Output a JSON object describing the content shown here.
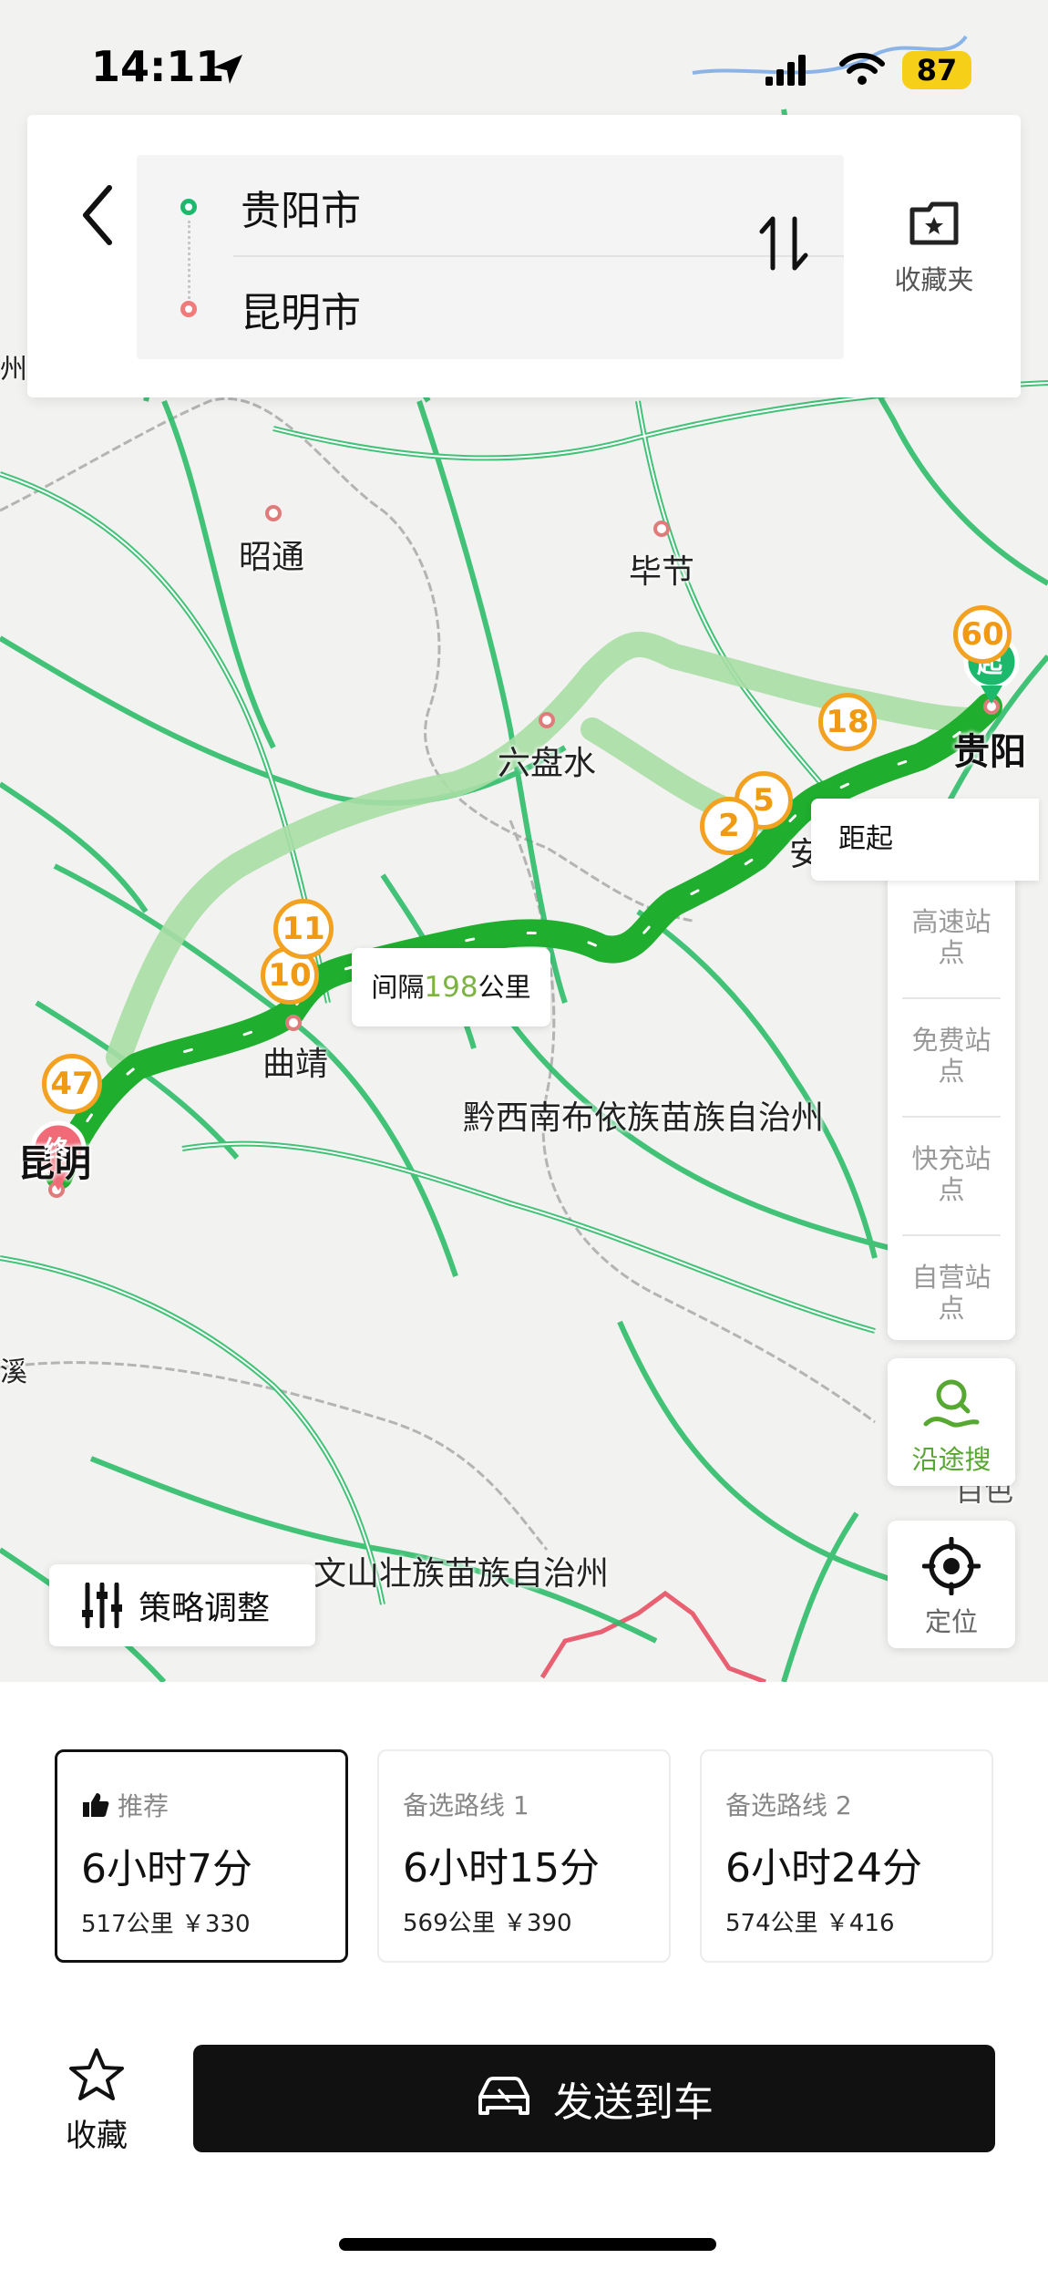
{
  "status_bar": {
    "time": "14:11",
    "battery": "87"
  },
  "route_card": {
    "start": "贵阳市",
    "end": "昆明市",
    "favorites_label": "收藏夹"
  },
  "map": {
    "labels": {
      "zhaotong": "昭通",
      "bijie": "毕节",
      "liupanshui": "六盘水",
      "guiyang": "贵阳",
      "qujing": "曲靖",
      "kunming": "昆明",
      "qianxinan": "黔西南布依族苗族自治州",
      "wenshan": "文山壮族苗族自治州",
      "an": "安",
      "baise": "百色",
      "zhou_left": "州",
      "xi_left": "溪"
    },
    "clusters": [
      "60",
      "18",
      "5",
      "2",
      "11",
      "10",
      "47"
    ],
    "start_marker": "起",
    "end_marker": "终",
    "interval": {
      "prefix": "间隔",
      "value": "198",
      "suffix": "公里"
    },
    "distance_pill": "距起",
    "stations": [
      "高速站点",
      "免费站点",
      "快充站点",
      "自营站点"
    ],
    "along_search_label": "沿途搜",
    "locate_label": "定位",
    "strategy_label": "策略调整"
  },
  "routes": [
    {
      "tag": "推荐",
      "duration": "6小时7分",
      "meta": "517公里 ￥330",
      "selected": true
    },
    {
      "tag": "备选路线 1",
      "duration": "6小时15分",
      "meta": "569公里 ￥390",
      "selected": false
    },
    {
      "tag": "备选路线 2",
      "duration": "6小时24分",
      "meta": "574公里 ￥416",
      "selected": false
    }
  ],
  "actions": {
    "collect_label": "收藏",
    "send_label": "发送到车"
  },
  "colors": {
    "route": "#1fae2e",
    "alt_route": "#a9dea4",
    "cluster": "#f2a120",
    "road": "#2fbd6a",
    "accent_green": "#57a832"
  }
}
